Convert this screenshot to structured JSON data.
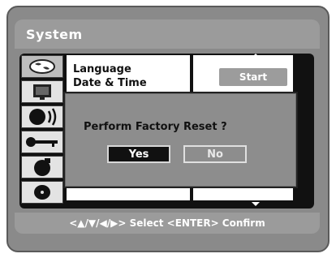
{
  "window": {
    "title": "System"
  },
  "sidebar": {
    "icons": [
      {
        "name": "globe-icon",
        "active": true
      },
      {
        "name": "display-icon",
        "active": false
      },
      {
        "name": "speaker-icon",
        "active": false
      },
      {
        "name": "key-icon",
        "active": false
      },
      {
        "name": "disc-player-icon",
        "active": false
      },
      {
        "name": "disc-icon",
        "active": false
      }
    ]
  },
  "menu": {
    "items": [
      "Language",
      "Date & Time"
    ]
  },
  "actions": {
    "start_label": "Start"
  },
  "dialog": {
    "message": "Perform  Factory Reset ?",
    "yes_label": "Yes",
    "no_label": "No",
    "selected": "Yes"
  },
  "footer": {
    "hint": "<▲/▼/◀/▶> Select  <ENTER> Confirm"
  },
  "colors": {
    "frame": "#8a8a8a",
    "panel": "#111111",
    "highlight": "#111111"
  }
}
